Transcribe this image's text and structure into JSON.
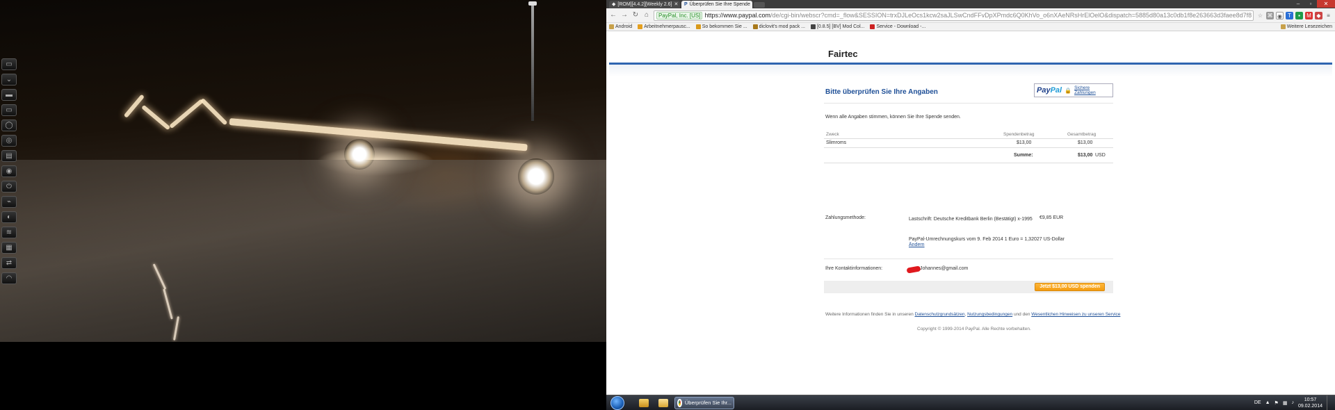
{
  "browser": {
    "tabs": [
      {
        "label": "[ROM][4.4.2][Weekly 2.6]",
        "active": false
      },
      {
        "label": "Überprüfen Sie Ihre Spende",
        "active": true
      }
    ],
    "omnibox": {
      "ev_badge": "PayPal, Inc. [US]",
      "host": "https://www.paypal.com",
      "path": "/de/cgi-bin/webscr?cmd=_flow&SESSION=trxDJLeOcs1kcw2saJLSwCndFFvDpXPmdc6Q0KhVo_o6nXAeNRsHrElOelO&dispatch=5885d80a13c0db1f8e263663d3faee8d7f8"
    },
    "bookmarks": [
      {
        "label": "Android",
        "color": "#c8a14a"
      },
      {
        "label": "Arbeitnehmerpausc...",
        "color": "#e5a020"
      },
      {
        "label": "So bekommen Sie ...",
        "color": "#d99a1c"
      },
      {
        "label": "diclovit's mod pack ...",
        "color": "#a8791a"
      },
      {
        "label": "[0.8.5] [BV] Mod Col...",
        "color": "#444444"
      },
      {
        "label": "Service - Download -...",
        "color": "#cc2222"
      }
    ],
    "bookmarks_other": "Weitere Lesezeichen"
  },
  "page": {
    "merchant": "Fairtec",
    "review_title": "Bitte überprüfen Sie Ihre Angaben",
    "paypal_logo_a": "Pay",
    "paypal_logo_b": "Pal",
    "secure_payments": "Sichere Zahlungen",
    "intro": "Wenn alle Angaben stimmen, können Sie Ihre Spende senden.",
    "table": {
      "headers": [
        "Zweck",
        "Spendenbetrag",
        "Gesamtbetrag"
      ],
      "row": [
        "Slimroms",
        "$13,00",
        "$13,00"
      ],
      "sum_label": "Summe:",
      "sum_value": "$13,00",
      "sum_currency": "USD"
    },
    "payment_method_label": "Zahlungsmethode:",
    "payment_method_value": "Lastschrift: Deutsche Kreditbank Berlin (Bestätigt) x-1995",
    "payment_amount": "€9,85 EUR",
    "conversion_text": "PayPal-Umrechnungskurs vom 9. Feb 2014 1 Euro = 1,32027 US-Dollar",
    "change_link": "Ändern",
    "contact_label": "Ihre Kontaktinformationen:",
    "contact_value": "Johannes@gmail.com",
    "donate_button": "Jetzt $13,00 USD spenden",
    "footer_prefix": "Weitere Informationen finden Sie in unseren",
    "footer_link1": "Datenschutzgrundsätzen",
    "footer_link2": "Nutzungsbedingungen",
    "footer_and": "und den",
    "footer_link3": "Wesentlichen Hinweisen zu unseren Service",
    "copyright": "Copyright © 1999-2014 PayPal. Alle Rechte vorbehalten."
  },
  "taskbar": {
    "active_task_label": "Überprüfen Sie Ihr...",
    "language": "DE",
    "time": "10:57",
    "date": "09.02.2014"
  },
  "colors": {
    "paypal_blue": "#1d4e96",
    "accent_rule": "#2f65b0",
    "donate_orange": "#f39c12"
  }
}
